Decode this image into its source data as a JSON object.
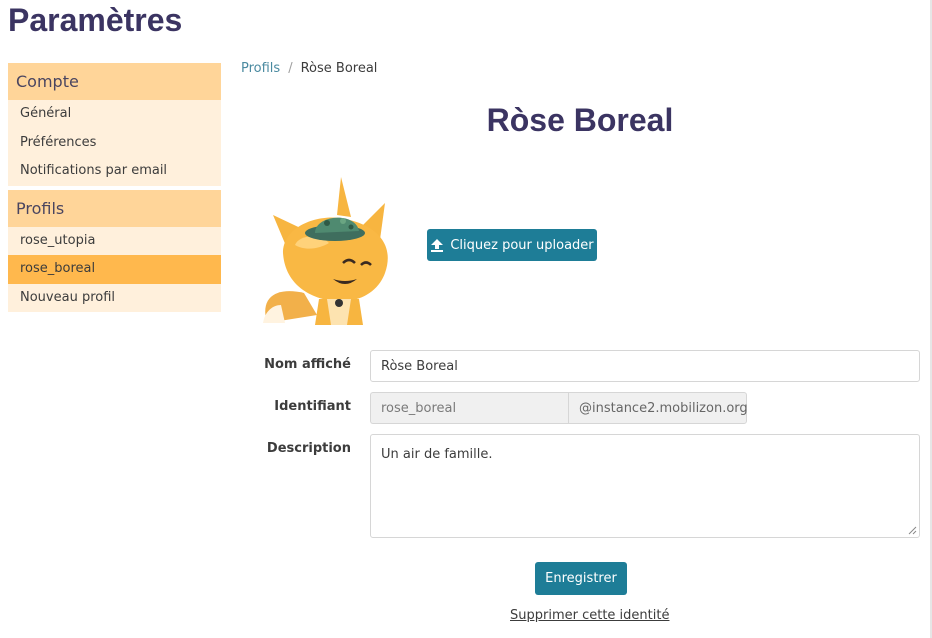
{
  "page_title": "Paramètres",
  "sidebar": {
    "groups": [
      {
        "label": "Compte",
        "items": [
          "Général",
          "Préférences",
          "Notifications par email"
        ]
      },
      {
        "label": "Profils",
        "items": [
          "rose_utopia",
          "rose_boreal",
          "Nouveau profil"
        ]
      }
    ],
    "active_item": "rose_boreal"
  },
  "breadcrumb": {
    "parent": "Profils",
    "separator": "/",
    "current": "Ròse Boreal"
  },
  "profile": {
    "title": "Ròse Boreal",
    "avatar": "fox-mascot-avatar"
  },
  "upload": {
    "label": "Cliquez pour uploader",
    "icon": "upload-icon"
  },
  "form": {
    "display_name": {
      "label": "Nom affiché",
      "value": "Ròse Boreal"
    },
    "identifier": {
      "label": "Identifiant",
      "value": "rose_boreal",
      "suffix": "@instance2.mobilizon.org"
    },
    "description": {
      "label": "Description",
      "value": "Un air de famille."
    }
  },
  "actions": {
    "save_label": "Enregistrer",
    "delete_label": "Supprimer cette identité"
  },
  "colors": {
    "primary": "#1e7d97",
    "title": "#3b3462",
    "sidebar_head": "#ffd599",
    "sidebar_item": "#fff0dc",
    "sidebar_active": "#ffb84d"
  }
}
